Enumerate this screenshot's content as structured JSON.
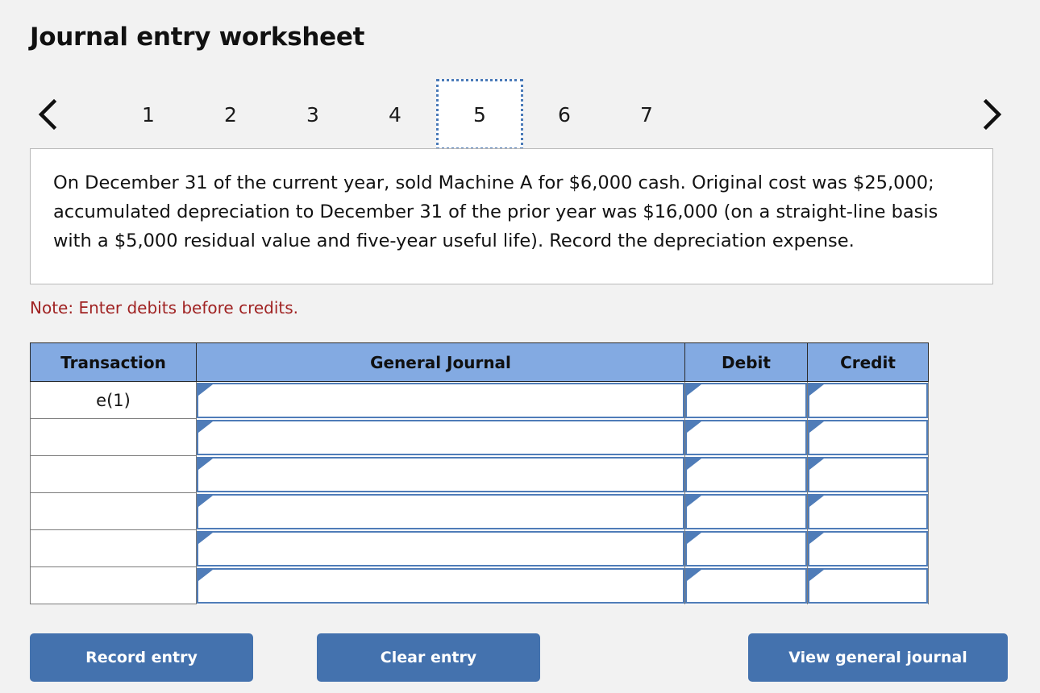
{
  "page": {
    "title": "Journal entry worksheet",
    "note": "Note: Enter debits before credits."
  },
  "pager": {
    "prev_label": "Previous",
    "next_label": "Next",
    "prev_icon": "chevron-left-icon",
    "next_icon": "chevron-right-icon",
    "selected": "5",
    "tabs": [
      {
        "label": "1"
      },
      {
        "label": "2"
      },
      {
        "label": "3"
      },
      {
        "label": "4"
      },
      {
        "label": "5"
      },
      {
        "label": "6"
      },
      {
        "label": "7"
      }
    ]
  },
  "description": {
    "text": "On December 31 of the current year, sold Machine A for $6,000 cash. Original cost was $25,000; accumulated depreciation to December 31 of the prior year was $16,000 (on a straight-line basis with a $5,000 residual value and five-year useful life). Record the depreciation expense."
  },
  "table": {
    "headers": {
      "transaction": "Transaction",
      "general_journal": "General Journal",
      "debit": "Debit",
      "credit": "Credit"
    },
    "rows": [
      {
        "transaction": "e(1)",
        "general_journal": "",
        "debit": "",
        "credit": ""
      },
      {
        "transaction": "",
        "general_journal": "",
        "debit": "",
        "credit": ""
      },
      {
        "transaction": "",
        "general_journal": "",
        "debit": "",
        "credit": ""
      },
      {
        "transaction": "",
        "general_journal": "",
        "debit": "",
        "credit": ""
      },
      {
        "transaction": "",
        "general_journal": "",
        "debit": "",
        "credit": ""
      },
      {
        "transaction": "",
        "general_journal": "",
        "debit": "",
        "credit": ""
      }
    ]
  },
  "buttons": {
    "record": "Record entry",
    "clear": "Clear entry",
    "view": "View general journal"
  },
  "colors": {
    "page_background": "#f2f2f2",
    "header_blue": "#83aae2",
    "button_blue": "#4472ae",
    "cell_border_blue": "#4f7cb8",
    "note_red": "#a02323",
    "selected_tab_border": "#4a7ab8"
  }
}
